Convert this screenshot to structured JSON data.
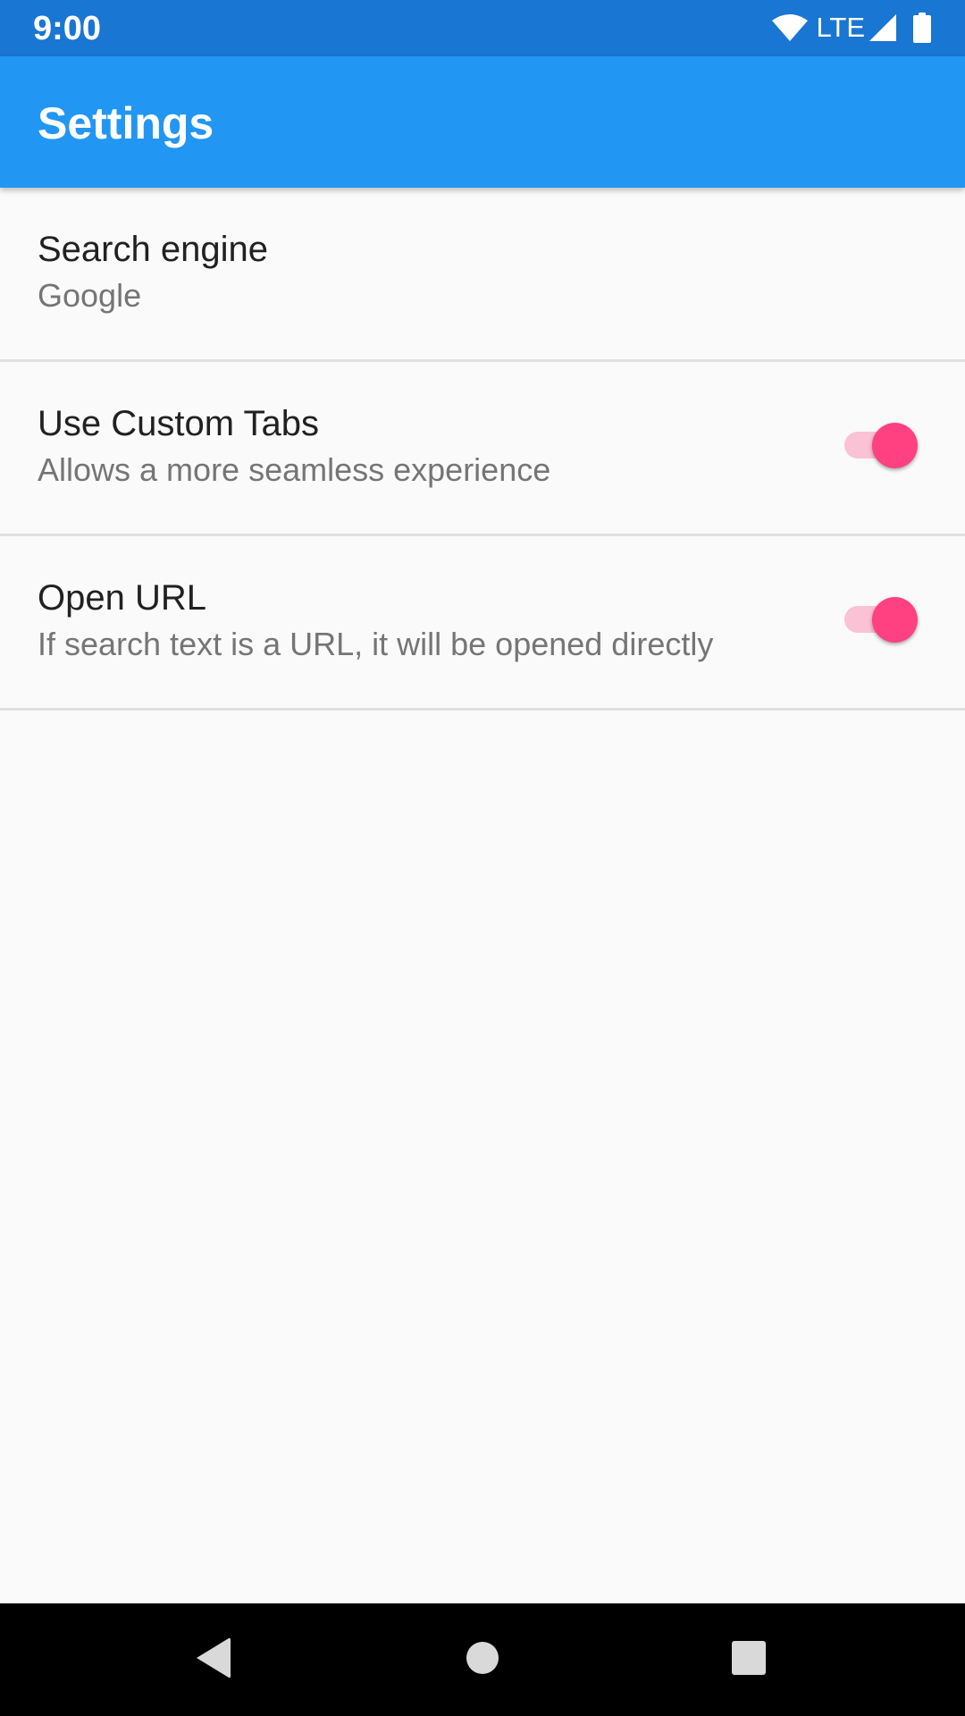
{
  "status_bar": {
    "time": "9:00",
    "network_label": "LTE",
    "icons": [
      "wifi-icon",
      "cellular-signal-icon",
      "battery-icon"
    ]
  },
  "app_bar": {
    "title": "Settings"
  },
  "preferences": [
    {
      "title": "Search engine",
      "summary": "Google"
    },
    {
      "title": "Use Custom Tabs",
      "summary": "Allows a more seamless experience",
      "switch_on": true
    },
    {
      "title": "Open URL",
      "summary": "If search text is a URL, it will be opened directly",
      "switch_on": true
    }
  ],
  "navigation_bar": {
    "buttons": [
      "back-icon",
      "home-icon",
      "recents-icon"
    ]
  },
  "colors": {
    "status_bar": "#1976d2",
    "app_bar": "#2196f3",
    "accent": "#ff4081",
    "background": "#fafafa",
    "divider": "#e0e0e0",
    "title_text": "#212121",
    "summary_text": "#757575"
  }
}
